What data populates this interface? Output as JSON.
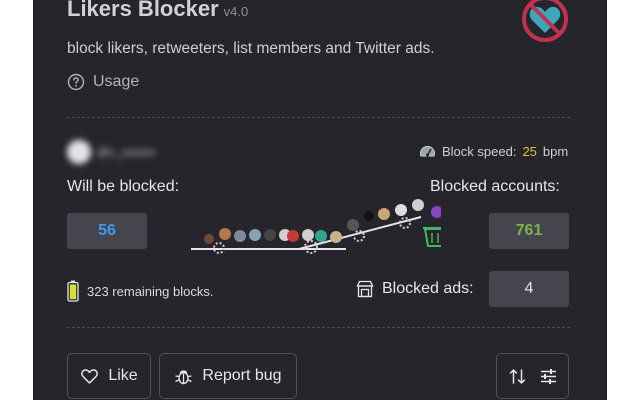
{
  "app": {
    "title": "Likers Blocker",
    "version": "v4.0",
    "description": "block likers, retweeters, list members and Twitter ads.",
    "logo_icon": "heart-blocked-logo-icon"
  },
  "usage": {
    "label": "Usage",
    "icon": "question-circle-icon"
  },
  "account": {
    "handle": "@c_ooooo"
  },
  "speed": {
    "label": "Block speed:",
    "value": "25",
    "unit": "bpm",
    "icon": "speedometer-icon"
  },
  "will_be_blocked": {
    "label": "Will be blocked:",
    "value": "56"
  },
  "blocked_accounts": {
    "label": "Blocked accounts:",
    "value": "761"
  },
  "remaining": {
    "text": "323 remaining blocks.",
    "icon": "battery-icon"
  },
  "ads": {
    "label": "Blocked ads:",
    "value": "4",
    "icon": "store-icon"
  },
  "buttons": {
    "like": {
      "label": "Like",
      "icon": "heart-icon"
    },
    "report": {
      "label": "Report bug",
      "icon": "bug-icon"
    },
    "settings": {
      "icons": [
        "sort-arrows-icon",
        "sliders-icon"
      ]
    }
  },
  "colors": {
    "panel_bg": "#25252b",
    "blue_accent": "#3d9be9",
    "green_accent": "#7fb34a",
    "yellow_accent": "#e3c531",
    "logo_red": "#c2324f",
    "logo_teal": "#3ba7b7"
  }
}
